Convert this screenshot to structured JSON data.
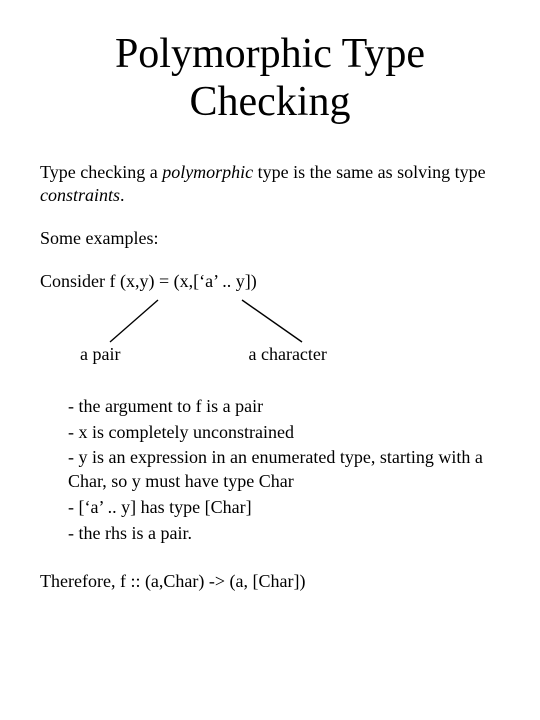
{
  "title_line1": "Polymorphic Type",
  "title_line2": "Checking",
  "intro_part1": "Type checking a ",
  "intro_italic1": "polymorphic",
  "intro_part2": " type is the same as solving type ",
  "intro_italic2": "constraints",
  "intro_part3": ".",
  "some_examples": "Some examples:",
  "consider_line": "Consider f (x,y) = (x,[‘a’ .. y])",
  "label_pair": "a pair",
  "label_char": "a character",
  "bullet1": "- the argument to f is a pair",
  "bullet2": "- x is completely unconstrained",
  "bullet3": "- y is an expression in an enumerated type, starting with a Char, so y must have type Char",
  "bullet4": "-  [‘a’ .. y]  has type [Char]",
  "bullet5": "- the rhs is a pair.",
  "conclusion": "Therefore, f :: (a,Char) -> (a, [Char])"
}
